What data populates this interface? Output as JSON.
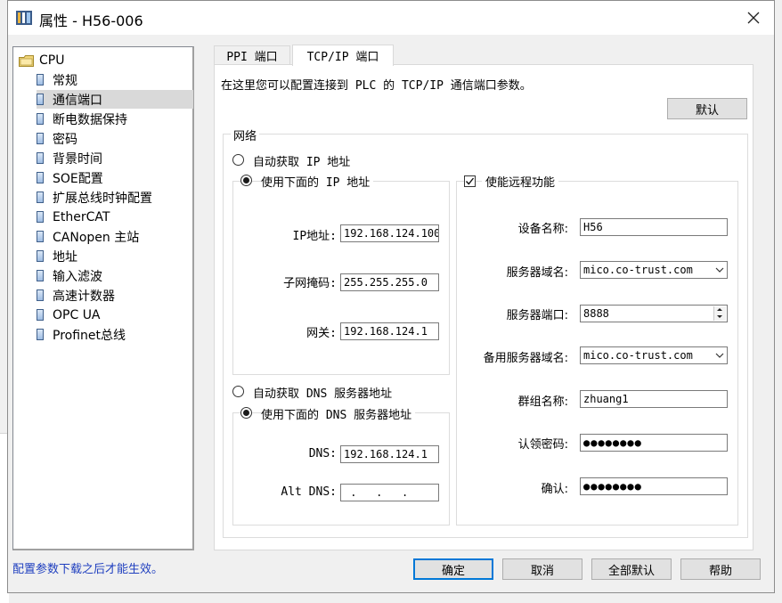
{
  "window": {
    "title": "属性 - H56-006"
  },
  "tree": {
    "root": "CPU",
    "items": [
      {
        "label": "常规"
      },
      {
        "label": "通信端口"
      },
      {
        "label": "断电数据保持"
      },
      {
        "label": "密码"
      },
      {
        "label": "背景时间"
      },
      {
        "label": "SOE配置"
      },
      {
        "label": "扩展总线时钟配置"
      },
      {
        "label": "EtherCAT"
      },
      {
        "label": "CANopen 主站"
      },
      {
        "label": "地址"
      },
      {
        "label": "输入滤波"
      },
      {
        "label": "高速计数器"
      },
      {
        "label": "OPC UA"
      },
      {
        "label": "Profinet总线"
      }
    ],
    "selected": "通信端口"
  },
  "tabs": [
    {
      "label": "PPI 端口"
    },
    {
      "label": "TCP/IP 端口"
    }
  ],
  "active_tab": "TCP/IP 端口",
  "intro": "在这里您可以配置连接到 PLC 的 TCP/IP 通信端口参数。",
  "default_button": "默认",
  "network": {
    "legend": "网络",
    "auto_ip": "自动获取 IP 地址",
    "manual_ip": "使用下面的 IP 地址",
    "ip_label": "IP地址:",
    "ip_value": "192.168.124.100",
    "mask_label": "子网掩码:",
    "mask_value": "255.255.255.0",
    "gateway_label": "网关:",
    "gateway_value": "192.168.124.1",
    "auto_dns": "自动获取 DNS 服务器地址",
    "manual_dns": "使用下面的 DNS 服务器地址",
    "dns_label": "DNS:",
    "dns_value": "192.168.124.1",
    "alt_dns_label": "Alt DNS:",
    "alt_dns_value": " .   .   . "
  },
  "remote": {
    "enable_label": "使能远程功能",
    "enabled": true,
    "device_name_label": "设备名称:",
    "device_name_value": "H56",
    "server_domain_label": "服务器域名:",
    "server_domain_value": "mico.co-trust.com",
    "server_port_label": "服务器端口:",
    "server_port_value": "8888",
    "backup_domain_label": "备用服务器域名:",
    "backup_domain_value": "mico.co-trust.com",
    "group_label": "群组名称:",
    "group_value": "zhuang1",
    "claim_pwd_label": "认领密码:",
    "claim_pwd_value": "●●●●●●●●",
    "confirm_label": "确认:",
    "confirm_value": "●●●●●●●●"
  },
  "footer": {
    "hint": "配置参数下载之后才能生效。",
    "ok": "确定",
    "cancel": "取消",
    "all_default": "全部默认",
    "help": "帮助"
  },
  "colors": {
    "accent": "#0078d7",
    "hint_text": "#1f3fbf",
    "selected_row": "#d9d9d9"
  }
}
